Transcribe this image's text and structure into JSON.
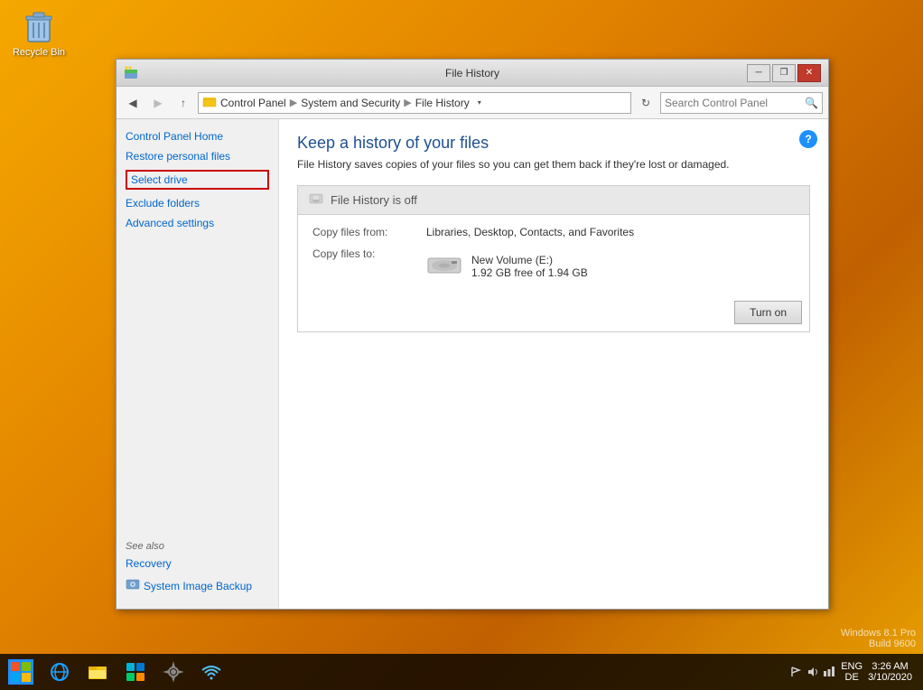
{
  "desktop": {
    "recycle_bin_label": "Recycle Bin"
  },
  "window": {
    "title": "File History",
    "icon": "folder-icon"
  },
  "titlebar": {
    "minimize_label": "─",
    "restore_label": "❐",
    "close_label": "✕"
  },
  "navbar": {
    "back_label": "◀",
    "forward_label": "▶",
    "up_label": "↑",
    "refresh_label": "↻",
    "breadcrumb": {
      "root_icon": "folder",
      "control_panel": "Control Panel",
      "system_security": "System and Security",
      "file_history": "File History"
    },
    "search_placeholder": "Search Control Panel"
  },
  "sidebar": {
    "links": [
      {
        "label": "Control Panel Home",
        "id": "cp-home"
      },
      {
        "label": "Restore personal files",
        "id": "restore-files"
      },
      {
        "label": "Select drive",
        "id": "select-drive",
        "selected": true
      },
      {
        "label": "Exclude folders",
        "id": "exclude-folders"
      },
      {
        "label": "Advanced settings",
        "id": "advanced-settings"
      }
    ],
    "see_also_title": "See also",
    "see_also_items": [
      {
        "label": "Recovery",
        "id": "recovery"
      },
      {
        "label": "System Image Backup",
        "id": "system-image-backup"
      }
    ]
  },
  "main": {
    "help_icon": "?",
    "page_title": "Keep a history of your files",
    "page_description": "File History saves copies of your files so you can get them back if they're lost or damaged.",
    "status_box": {
      "header": "File History is off",
      "copy_from_label": "Copy files from:",
      "copy_from_value": "Libraries, Desktop, Contacts, and Favorites",
      "copy_to_label": "Copy files to:",
      "drive_name": "New Volume (E:)",
      "drive_space": "1.92 GB free of 1.94 GB"
    },
    "turn_on_btn": "Turn on"
  },
  "taskbar": {
    "start_icon": "⊞",
    "items": [
      {
        "id": "ie",
        "icon": "ie",
        "color": "#1a9fff"
      },
      {
        "id": "file-explorer",
        "icon": "folder",
        "color": "#f5c518"
      },
      {
        "id": "store",
        "icon": "store",
        "color": "#00b4d8"
      },
      {
        "id": "settings",
        "icon": "gear",
        "color": "#888"
      },
      {
        "id": "network",
        "icon": "network",
        "color": "#4fc3f7"
      }
    ],
    "lang": "ENG\nDE",
    "time": "3:26 AM",
    "date": "3/10/2020"
  },
  "watermark": {
    "line1": "Windows 8.1 Pro",
    "line2": "Build 9600"
  }
}
